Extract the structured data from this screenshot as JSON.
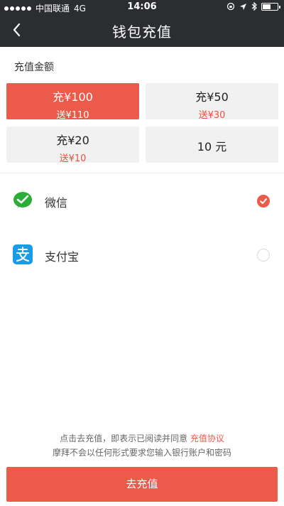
{
  "status_bar": {
    "carrier": "中国联通",
    "network": "4G",
    "time": "14:06",
    "battery_level": 0.55
  },
  "nav": {
    "title": "钱包充值",
    "back_icon": "chevron-left-icon"
  },
  "amount_section": {
    "label": "充值金额",
    "options": [
      {
        "main": "充¥100",
        "bonus": "送¥110",
        "selected": true
      },
      {
        "main": "充¥50",
        "bonus": "送¥30",
        "selected": false
      },
      {
        "main": "充¥20",
        "bonus": "送¥10",
        "selected": false
      },
      {
        "main": "10 元",
        "bonus": "",
        "selected": false
      }
    ]
  },
  "payment_methods": [
    {
      "name": "微信",
      "icon": "wechat-icon",
      "selected": true
    },
    {
      "name": "支付宝",
      "icon": "alipay-icon",
      "selected": false
    }
  ],
  "notice": {
    "line1_prefix": "点击去充值，即表示已阅读并同意",
    "line1_link": "充值协议",
    "line2": "摩拜不会以任何形式要求您输入银行账户和密码"
  },
  "submit_label": "去充值",
  "colors": {
    "accent": "#ec5a49",
    "navbar": "#2b2d31",
    "wechat": "#2aae38",
    "alipay": "#1a9be6"
  }
}
